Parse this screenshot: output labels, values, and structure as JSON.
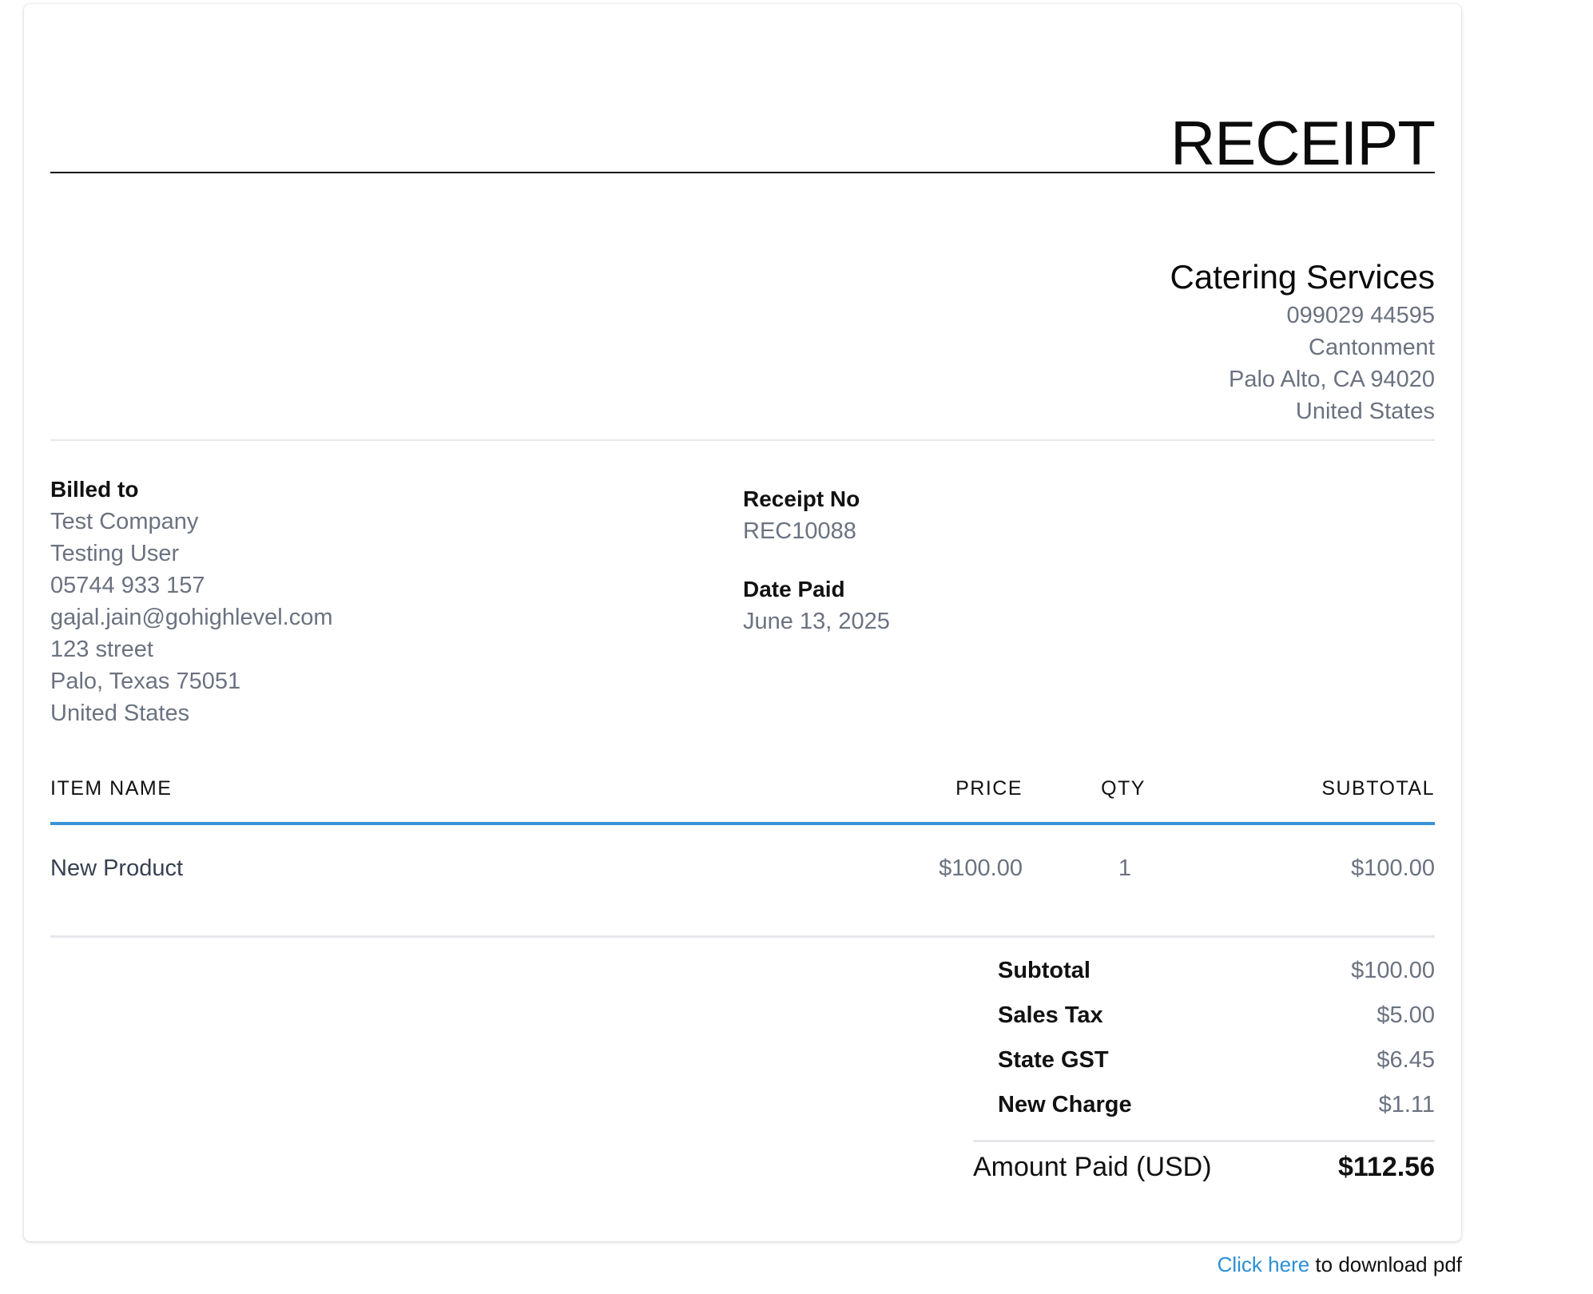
{
  "receipt": {
    "title": "RECEIPT",
    "company": {
      "name": "Catering Services",
      "phone": "099029 44595",
      "address_line1": "Cantonment",
      "address_line2": "Palo Alto, CA 94020",
      "country": "United States"
    },
    "billed_to": {
      "label": "Billed to",
      "lines": [
        "Test Company",
        "Testing User",
        "05744 933 157",
        "gajal.jain@gohighlevel.com",
        "123 street",
        "Palo, Texas 75051",
        "United States"
      ]
    },
    "meta": {
      "receipt_no_label": "Receipt No",
      "receipt_no": "REC10088",
      "date_paid_label": "Date Paid",
      "date_paid": "June 13, 2025"
    },
    "table": {
      "headers": {
        "item": "ITEM NAME",
        "price": "PRICE",
        "qty": "QTY",
        "subtotal": "SUBTOTAL"
      },
      "rows": [
        {
          "item": "New Product",
          "price": "$100.00",
          "qty": "1",
          "subtotal": "$100.00"
        }
      ]
    },
    "totals": [
      {
        "label": "Subtotal",
        "value": "$100.00"
      },
      {
        "label": "Sales Tax",
        "value": "$5.00"
      },
      {
        "label": "State GST",
        "value": "$6.45"
      },
      {
        "label": "New Charge",
        "value": "$1.11"
      }
    ],
    "amount_paid": {
      "label": "Amount Paid (USD)",
      "value": "$112.56"
    }
  },
  "footer": {
    "link_text": "Click here",
    "rest_text": " to download pdf"
  },
  "colors": {
    "link": "#2b8fd6",
    "table_rule": "#3a93d6",
    "muted_text": "#6b7280"
  }
}
